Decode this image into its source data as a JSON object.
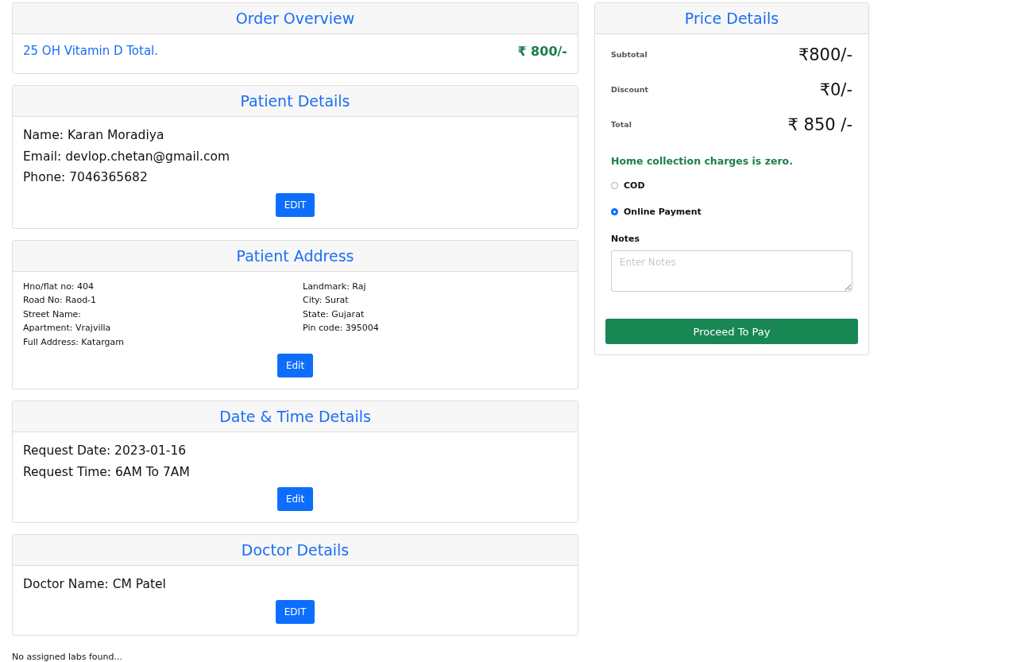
{
  "sections": [
    {
      "kind": "overview",
      "title": "Order Overview",
      "item": "25 OH Vitamin D Total.",
      "price": "₹ 800/-"
    },
    {
      "kind": "lines",
      "title": "Patient Details",
      "lines": [
        "Name: Karan Moradiya",
        "Email: devlop.chetan@gmail.com",
        "Phone: 7046365682"
      ],
      "button": "EDIT"
    },
    {
      "kind": "address",
      "title": "Patient Address",
      "left": [
        "Hno/flat no: 404",
        "Road No: Raod-1",
        "Street Name:",
        "Apartment: Vrajvilla",
        "Full Address: Katargam"
      ],
      "right": [
        "Landmark: Raj",
        "City: Surat",
        "State: Gujarat",
        "Pin code: 395004"
      ],
      "button": "Edit"
    },
    {
      "kind": "lines",
      "title": "Date & Time Details",
      "lines": [
        "Request Date: 2023-01-16",
        "Request Time: 6AM To 7AM"
      ],
      "button": "Edit"
    },
    {
      "kind": "lines",
      "title": "Doctor Details",
      "lines": [
        "Doctor Name: CM Patel"
      ],
      "button": "EDIT"
    }
  ],
  "footer_note": "No assigned labs found...",
  "price_details": {
    "title": "Price Details",
    "rows": [
      {
        "label": "Subtotal",
        "value": "₹800/-"
      },
      {
        "label": "Discount",
        "value": "₹0/-"
      },
      {
        "label": "Total",
        "value": "₹ 850 /-"
      }
    ],
    "note": "Home collection charges is zero.",
    "payment_options": [
      {
        "label": "COD",
        "selected": false
      },
      {
        "label": "Online Payment",
        "selected": true
      }
    ],
    "notes_label": "Notes",
    "notes_placeholder": "Enter Notes",
    "submit": "Proceed To Pay"
  }
}
